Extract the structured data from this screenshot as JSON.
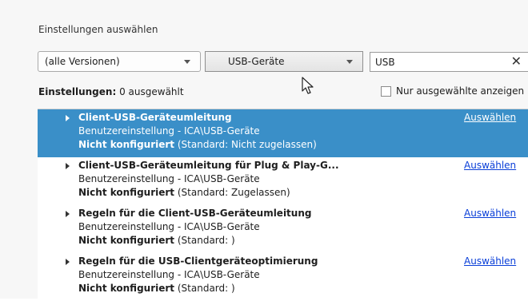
{
  "panel": {
    "title": "Einstellungen auswählen"
  },
  "filters": {
    "version_selected": "(alle Versionen)",
    "category_selected": "USB-Geräte",
    "search_value": "USB",
    "clear_symbol": "✕"
  },
  "status": {
    "count_label": "Einstellungen:",
    "count_value": "0 ausgewählt",
    "show_selected_label": "Nur ausgewählte anzeigen"
  },
  "settings": [
    {
      "name": "Client-USB-Geräteumleitung",
      "path": "Benutzereinstellung - ICA\\USB-Geräte",
      "state_label": "Nicht konfiguriert",
      "state_default": "(Standard: Nicht zugelassen)",
      "action": "Auswählen",
      "selected": true
    },
    {
      "name": "Client-USB-Geräteumleitung für Plug & Play-G...",
      "path": "Benutzereinstellung - ICA\\USB-Geräte",
      "state_label": "Nicht konfiguriert",
      "state_default": "(Standard: Zugelassen)",
      "action": "Auswählen",
      "selected": false
    },
    {
      "name": "Regeln für die Client-USB-Geräteumleitung",
      "path": "Benutzereinstellung - ICA\\USB-Geräte",
      "state_label": "Nicht konfiguriert",
      "state_default": "(Standard: )",
      "action": "Auswählen",
      "selected": false
    },
    {
      "name": "Regeln für die USB-Clientgeräteoptimierung",
      "path": "Benutzereinstellung - ICA\\USB-Geräte",
      "state_label": "Nicht konfiguriert",
      "state_default": "(Standard: )",
      "action": "Auswählen",
      "selected": false
    }
  ],
  "colors": {
    "selection": "#3a8fc8",
    "link": "#0a3fd8"
  }
}
